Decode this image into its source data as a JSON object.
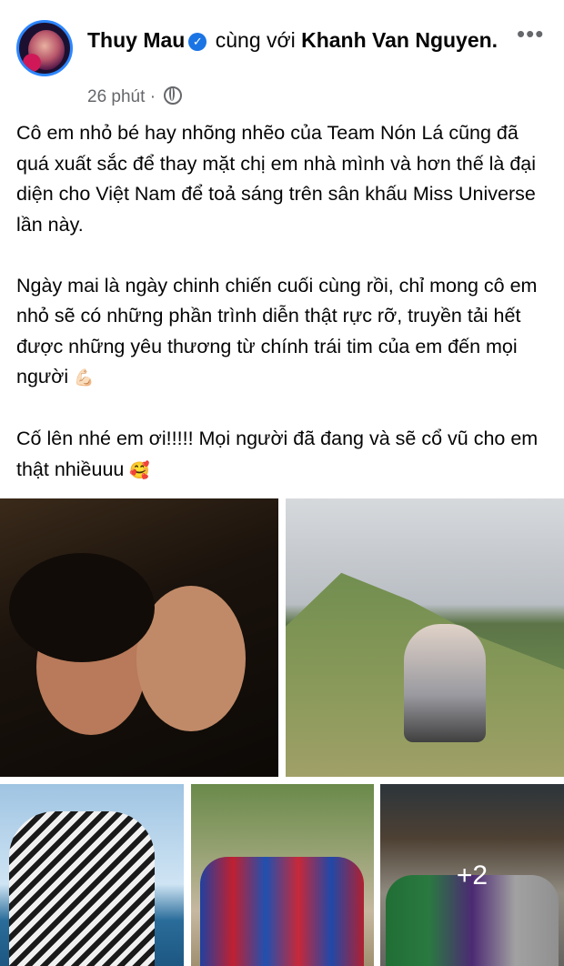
{
  "post": {
    "author": "Thuy Mau",
    "with_text": "cùng với",
    "tagged": "Khanh Van Nguyen.",
    "time": "26 phút",
    "dot": "·",
    "more_icon": "more-horizontal-icon",
    "verified_icon": "verified-badge-icon",
    "privacy_icon": "globe-icon",
    "paragraphs": [
      "Cô em nhỏ bé hay nhõng nhẽo của Team Nón Lá cũng đã quá xuất sắc để thay mặt chị em nhà mình và hơn thế là đại diện cho Việt Nam để toả sáng trên sân khấu Miss Universe lần này.",
      "Ngày mai là ngày chinh chiến cuối cùng rồi, chỉ mong cô em nhỏ sẽ có những phần trình diễn thật rực rỡ, truyền tải hết được những yêu thương từ chính trái tim của em đến mọi người",
      "Cố lên nhé em ơi!!!!! Mọi người đã đang và sẽ cổ vũ cho em thật nhiềuuu"
    ],
    "emoji_1": "💪🏻",
    "emoji_2": "🥰",
    "more_photos": "+2"
  }
}
